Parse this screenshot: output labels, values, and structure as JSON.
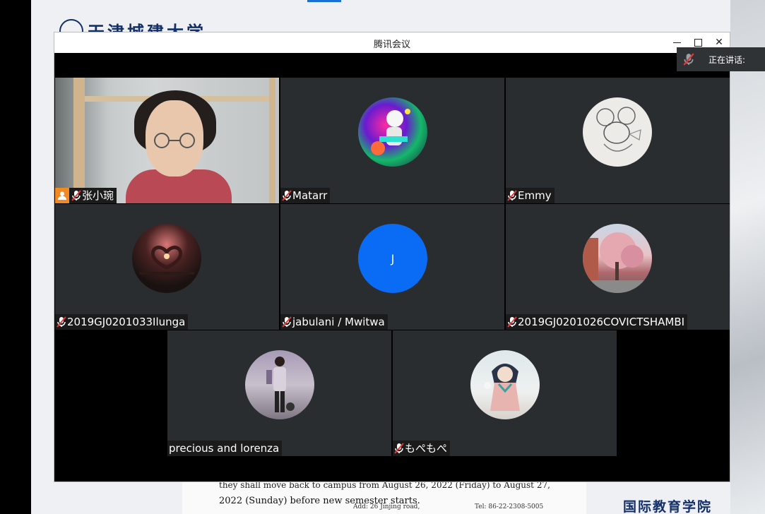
{
  "window": {
    "title": "腾讯会议"
  },
  "speaking_indicator": {
    "label": "正在讲话:"
  },
  "participants": [
    {
      "name": "张小琬",
      "muted": true,
      "host": true,
      "video_on": true
    },
    {
      "name": "Matarr",
      "muted": true,
      "avatar": "astronaut-art"
    },
    {
      "name": "Emmy",
      "muted": true,
      "avatar": "cartoon-mouse-sketch"
    },
    {
      "name": "2019GJ0201033Ilunga",
      "muted": true,
      "avatar": "heart-hands-sunset"
    },
    {
      "name": "jabulani / Mwitwa",
      "muted": true,
      "avatar_letter": "J",
      "avatar_color": "#0a6cf5"
    },
    {
      "name": "2019GJ0201026COVICTSHAMBI",
      "muted": true,
      "avatar": "cherry-blossom-tree"
    },
    {
      "name": "precious and lorenza",
      "muted": false,
      "avatar": "person-standing-photo"
    },
    {
      "name": "もぺもぺ",
      "muted": true,
      "avatar": "anime-character"
    }
  ],
  "background": {
    "university_name": "天津城建大学",
    "doc_line_1": "they shall move back to campus from August 26, 2022 (Friday) to August 27,",
    "doc_line_2": "2022 (Sunday) before new semester starts.",
    "address_label": "Add:   26 Jinjing road,",
    "tel_label": "Tel:   86-22-2308-5005",
    "college_name": "国际教育学院"
  },
  "colors": {
    "tile_bg": "#2a2d30",
    "host_badge": "#f28a24",
    "accent": "#0a6cf5"
  }
}
